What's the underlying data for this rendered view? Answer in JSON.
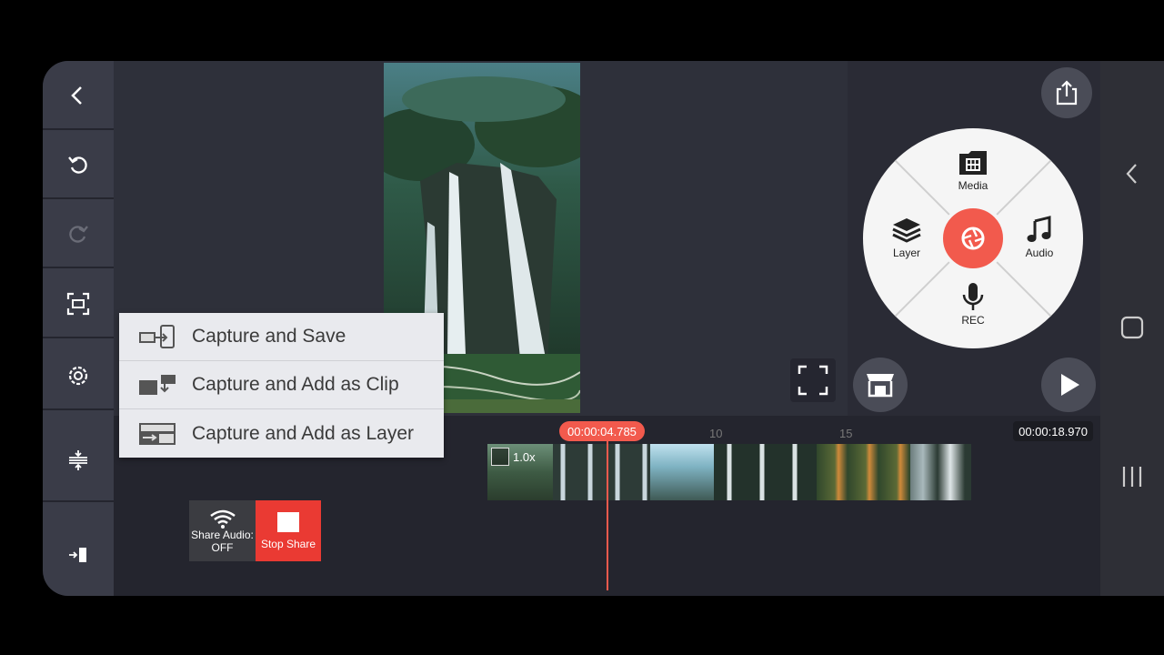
{
  "left_toolbar": {
    "items": [
      "back-icon",
      "undo-icon",
      "redo-icon",
      "screen-capture-icon",
      "settings-icon",
      "align-icon",
      "exit-icon"
    ]
  },
  "right_wheel": {
    "media_label": "Media",
    "layer_label": "Layer",
    "audio_label": "Audio",
    "rec_label": "REC"
  },
  "timeline": {
    "current_time": "00:00:04.785",
    "total_time": "00:00:18.970",
    "ruler_ticks": [
      "10",
      "15"
    ],
    "speed_label": "1.0x",
    "playhead_fraction": 0.252
  },
  "share_widget": {
    "share_audio_label_line1": "Share Audio:",
    "share_audio_label_line2": "OFF",
    "stop_share_label": "Stop Share"
  },
  "capture_menu": {
    "items": [
      "Capture and Save",
      "Capture and Add as Clip",
      "Capture and Add as Layer"
    ]
  },
  "colors": {
    "accent": "#f25a4d",
    "toolbar_bg": "#3a3c48",
    "stop_share": "#ea3a33"
  }
}
